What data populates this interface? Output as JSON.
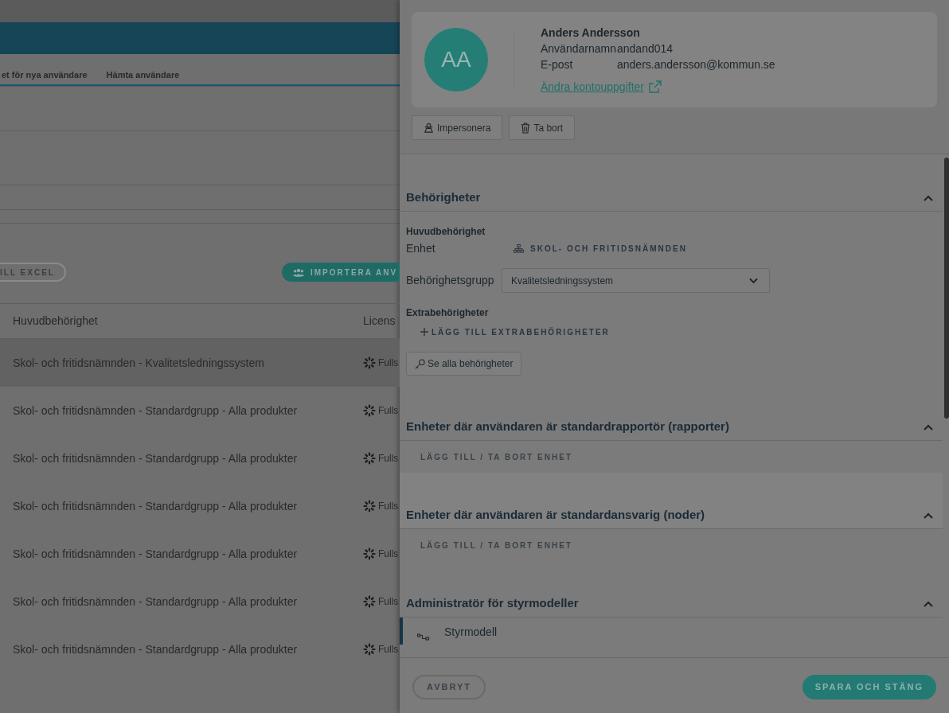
{
  "main": {
    "tabs": [
      "et för nya användare",
      "Hämta användare"
    ],
    "actions": [
      {
        "label": "ILL EXCEL",
        "kind": "outline"
      },
      {
        "label": "IMPORTERA ANV",
        "kind": "primary"
      }
    ],
    "table": {
      "columns": [
        "Huvudbehörighet",
        "Licens"
      ],
      "rows": [
        {
          "cells": [
            "Skol- och fritidsnämnden - Kvalitetsledningssystem",
            "Fulls"
          ],
          "selected": true
        },
        {
          "cells": [
            "Skol- och fritidsnämnden - Standardgrupp - Alla produkter",
            "Fulls"
          ],
          "selected": false
        },
        {
          "cells": [
            "Skol- och fritidsnämnden - Standardgrupp - Alla produkter",
            "Fulls"
          ],
          "selected": false
        },
        {
          "cells": [
            "Skol- och fritidsnämnden - Standardgrupp - Alla produkter",
            "Fulls"
          ],
          "selected": false
        },
        {
          "cells": [
            "Skol- och fritidsnämnden - Standardgrupp - Alla produkter",
            "Fulls"
          ],
          "selected": false
        },
        {
          "cells": [
            "Skol- och fritidsnämnden - Standardgrupp - Alla produkter",
            "Fulls"
          ],
          "selected": false
        },
        {
          "cells": [
            "Skol- och fritidsnämnden - Standardgrupp - Alla produkter",
            "Fulls"
          ],
          "selected": false
        }
      ]
    }
  },
  "user_panel": {
    "avatar_initials": "AA",
    "name": "Anders Andersson",
    "fields": [
      {
        "label": "Användarnamn",
        "value": "andand014"
      },
      {
        "label": "E-post",
        "value": "anders.andersson@kommun.se"
      }
    ],
    "account_link": "Ändra kontouppgifter",
    "buttons": [
      {
        "label": "Impersonera",
        "kind": "impersonate"
      },
      {
        "label": "Ta bort",
        "kind": "delete"
      }
    ],
    "sections": [
      {
        "kind": "permissions",
        "title": "Behörigheter",
        "expanded": true,
        "subheading": "Huvudbehörighet",
        "unit_label": "Enhet",
        "unit_value": "SKOL- OCH FRITIDSNÄMNDEN",
        "group_label": "Behörighetsgrupp",
        "group_value": "Kvalitetsledningssystem",
        "extra_heading": "Extrabehörigheter",
        "extra_link": "LÄGG TILL EXTRABEHÖRIGHETER",
        "view_button": "Se alla behörigheter"
      },
      {
        "kind": "units",
        "title": "Enheter där användaren är standardrapportör (rapporter)",
        "expanded": true,
        "link": "LÄGG TILL / TA BORT ENHET",
        "hovered": false
      },
      {
        "kind": "units",
        "title": "Enheter där användaren är standardansvarig (noder)",
        "expanded": true,
        "link": "LÄGG TILL / TA BORT ENHET",
        "hovered": true
      },
      {
        "kind": "models",
        "title": "Administratör för styrmodeller",
        "expanded": true,
        "items": [
          "Styrmodell"
        ]
      }
    ],
    "footer": {
      "cancel": "AVBRYT",
      "save": "SPARA OCH STÄNG"
    }
  }
}
